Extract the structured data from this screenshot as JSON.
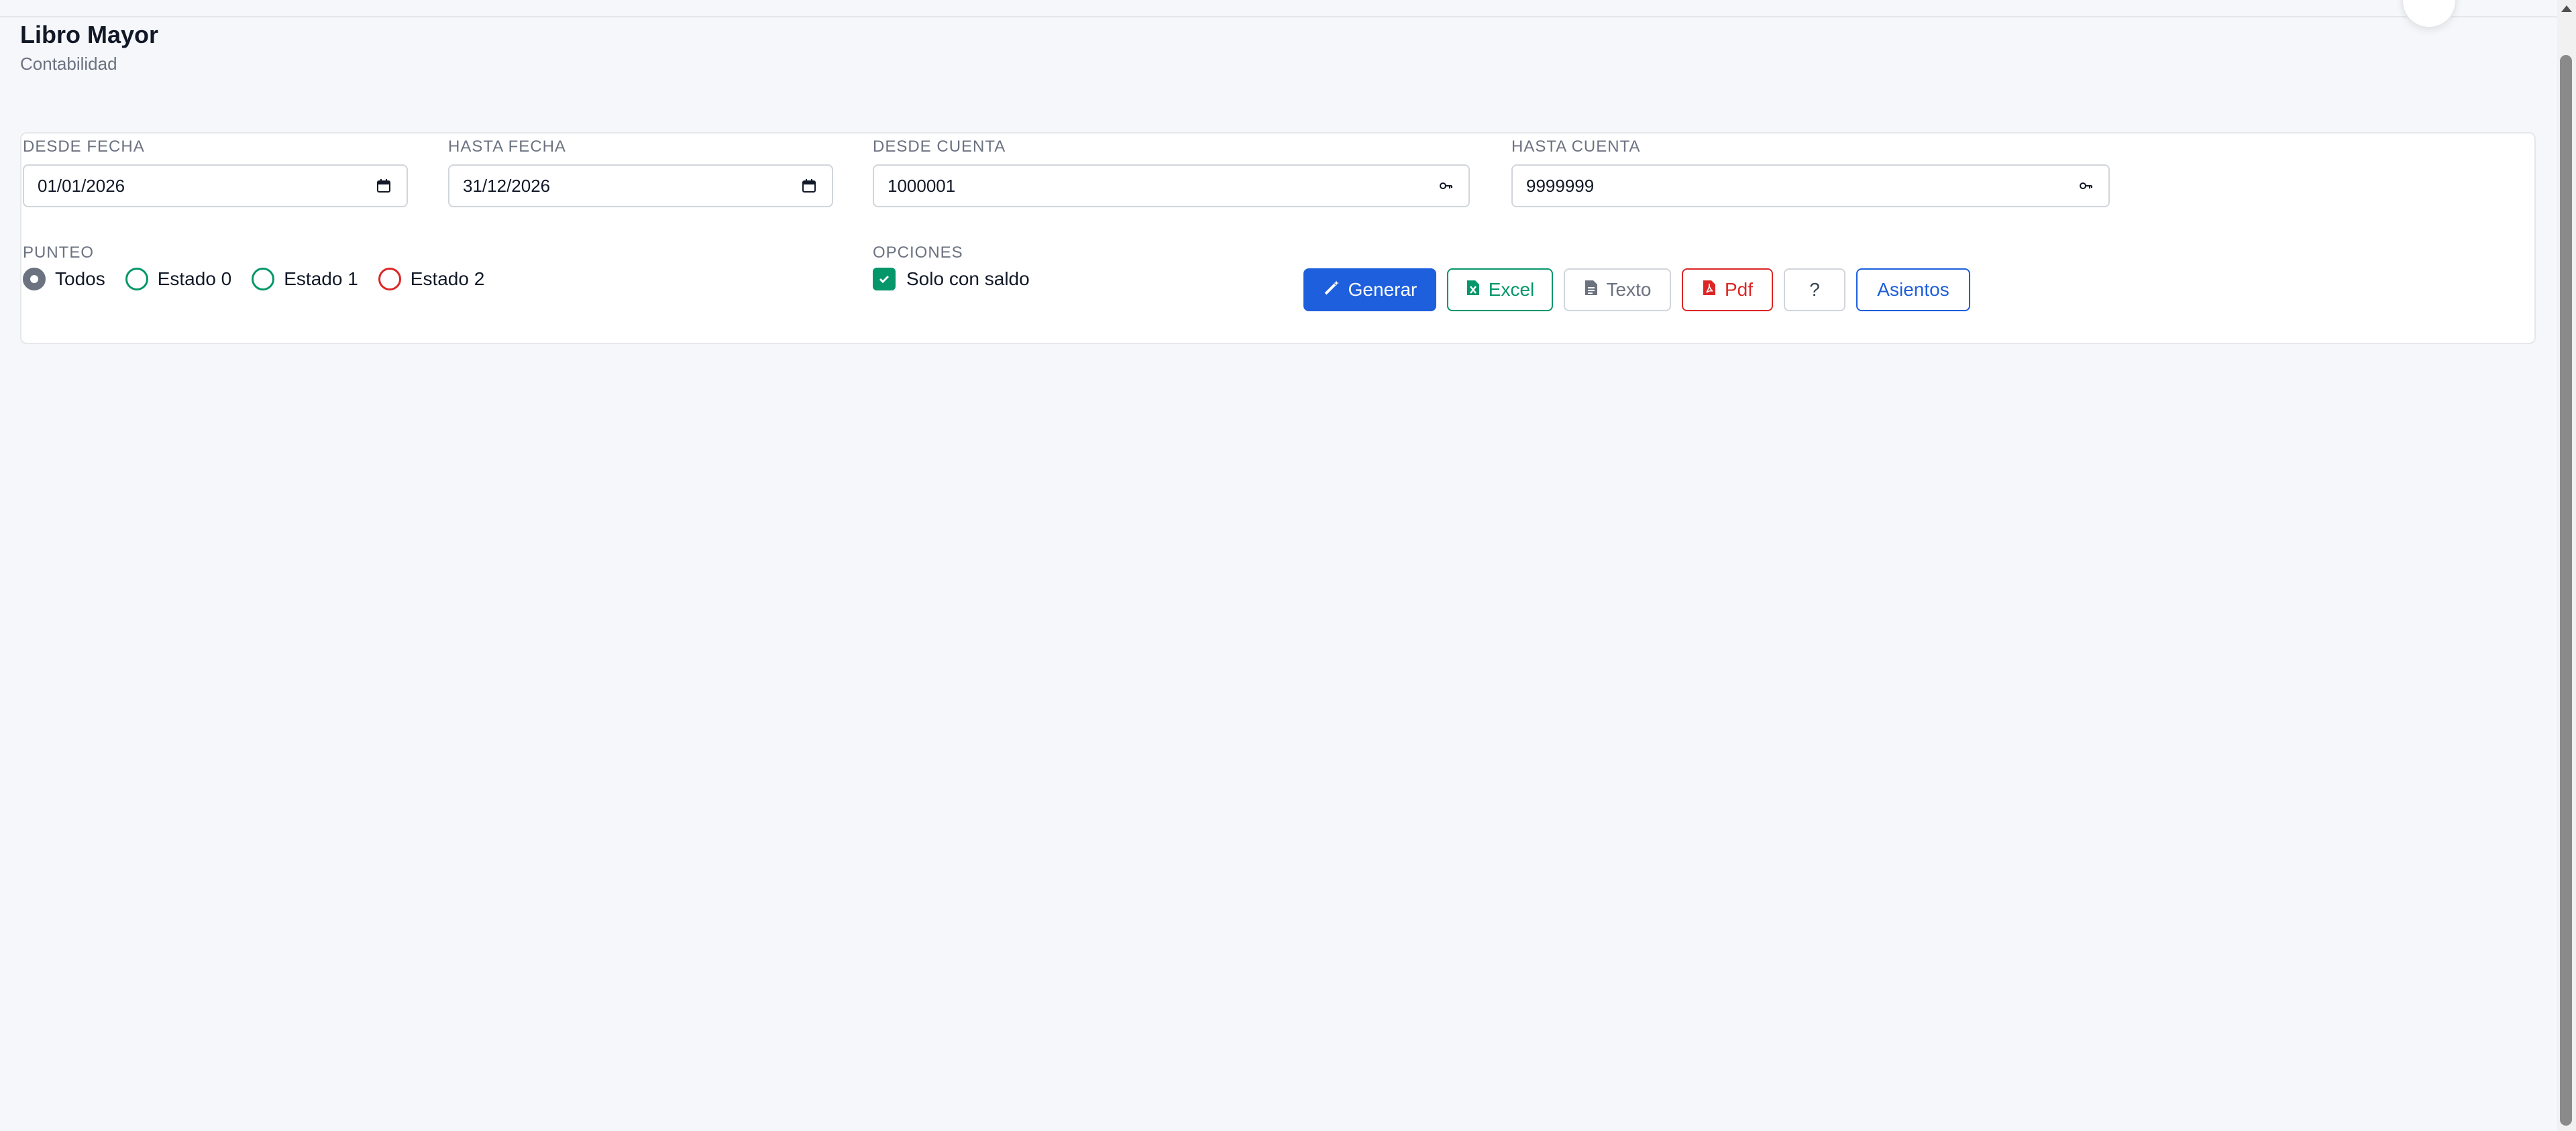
{
  "page": {
    "title": "Libro Mayor",
    "subtitle": "Contabilidad"
  },
  "filters": {
    "desde_fecha": {
      "label": "DESDE FECHA",
      "value": "01/01/2026"
    },
    "hasta_fecha": {
      "label": "HASTA FECHA",
      "value": "31/12/2026"
    },
    "desde_cuenta": {
      "label": "DESDE CUENTA",
      "value": "1000001"
    },
    "hasta_cuenta": {
      "label": "HASTA CUENTA",
      "value": "9999999"
    }
  },
  "punteo": {
    "label": "PUNTEO",
    "options": [
      "Todos",
      "Estado 0",
      "Estado 1",
      "Estado 2"
    ],
    "selected": "Todos"
  },
  "opciones": {
    "label": "OPCIONES",
    "solo_con_saldo": {
      "label": "Solo con saldo",
      "checked": true
    }
  },
  "actions": {
    "generar": "Generar",
    "excel": "Excel",
    "texto": "Texto",
    "pdf": "Pdf",
    "help": "?",
    "asientos": "Asientos"
  },
  "colors": {
    "primary": "#1d5fdc",
    "success": "#059669",
    "danger": "#dc2626",
    "muted": "#6b7280"
  }
}
